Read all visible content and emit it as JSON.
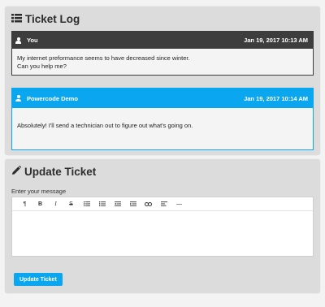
{
  "ticket_log": {
    "title": "Ticket Log",
    "title_icon": "list-icon",
    "messages": [
      {
        "author": "You",
        "timestamp": "Jan 19, 2017 10:13 AM",
        "body_lines": [
          "My internet preformance seems to have decreased since winter.",
          "Can you help me?"
        ],
        "header_color": "#3d3d3d",
        "icon": "user-icon"
      },
      {
        "author": "Powercode Demo",
        "timestamp": "Jan 19, 2017 10:14 AM",
        "body_lines": [
          "Absolutely! I'll send a technician out to figure out what's going on."
        ],
        "header_color": "#0aa7f0",
        "icon": "user-icon"
      }
    ]
  },
  "update_ticket": {
    "title": "Update Ticket",
    "title_icon": "pencil-icon",
    "label": "Enter your message",
    "toolbar": [
      {
        "name": "paragraph",
        "glyph": "¶"
      },
      {
        "name": "bold",
        "glyph": "B"
      },
      {
        "name": "italic",
        "glyph": "I"
      },
      {
        "name": "strikethrough",
        "glyph": "S"
      },
      {
        "name": "unordered-list",
        "glyph": ""
      },
      {
        "name": "ordered-list",
        "glyph": ""
      },
      {
        "name": "outdent",
        "glyph": ""
      },
      {
        "name": "indent",
        "glyph": ""
      },
      {
        "name": "link",
        "glyph": ""
      },
      {
        "name": "align",
        "glyph": ""
      },
      {
        "name": "horizontal-rule",
        "glyph": "—"
      }
    ],
    "message_value": "",
    "submit_label": "Update Ticket",
    "accent_color": "#0aa7f0"
  }
}
